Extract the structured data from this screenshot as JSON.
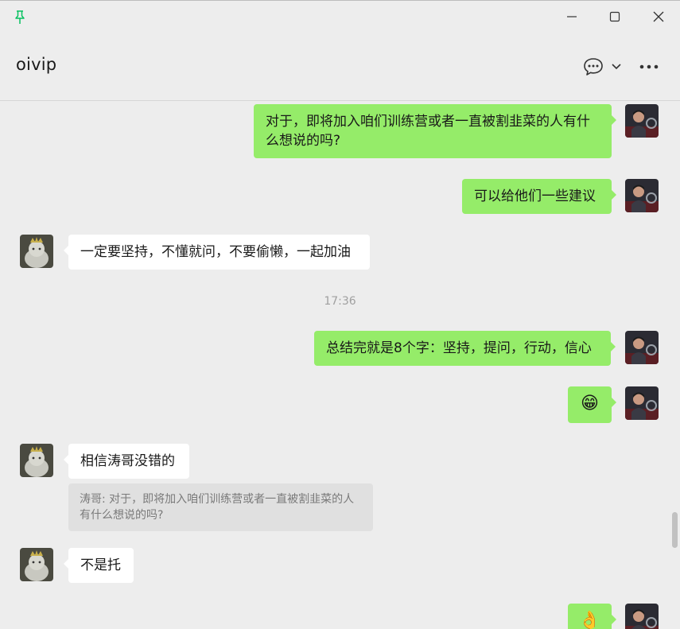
{
  "window": {
    "pin_icon": "pin-icon",
    "minimize_icon": "minimize-icon",
    "maximize_icon": "maximize-icon",
    "close_icon": "close-icon"
  },
  "header": {
    "title": "oivip",
    "chat_icon": "chat-bubble-icon",
    "dropdown_icon": "chevron-down-icon",
    "more_icon": "more-icon"
  },
  "colors": {
    "my_bubble": "#95ec69",
    "their_bubble": "#ffffff",
    "background": "#ededed",
    "pin_accent": "#07c160"
  },
  "messages": [
    {
      "from": "me",
      "text": "对于，即将加入咱们训练营或者一直被割韭菜的人有什么想说的吗?"
    },
    {
      "from": "me",
      "text": "可以给他们一些建议"
    },
    {
      "from": "other",
      "text": "一定要坚持，不懂就问，不要偷懒，一起加油"
    },
    {
      "timestamp": "17:36"
    },
    {
      "from": "me",
      "text": "总结完就是8个字：坚持，提问，行动，信心"
    },
    {
      "from": "me",
      "emoji": "😁"
    },
    {
      "from": "other",
      "text": "相信涛哥没错的",
      "quote": "涛哥: 对于，即将加入咱们训练营或者一直被割韭菜的人有什么想说的吗?"
    },
    {
      "from": "other",
      "text": "不是托"
    },
    {
      "from": "me",
      "emoji": "👌"
    }
  ]
}
